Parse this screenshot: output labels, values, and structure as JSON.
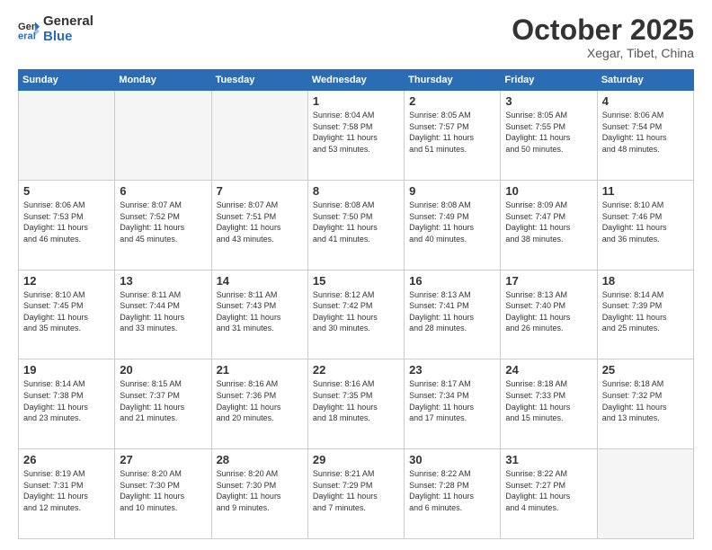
{
  "logo": {
    "line1": "General",
    "line2": "Blue"
  },
  "header": {
    "month": "October 2025",
    "location": "Xegar, Tibet, China"
  },
  "weekdays": [
    "Sunday",
    "Monday",
    "Tuesday",
    "Wednesday",
    "Thursday",
    "Friday",
    "Saturday"
  ],
  "weeks": [
    [
      {
        "day": "",
        "info": ""
      },
      {
        "day": "",
        "info": ""
      },
      {
        "day": "",
        "info": ""
      },
      {
        "day": "1",
        "info": "Sunrise: 8:04 AM\nSunset: 7:58 PM\nDaylight: 11 hours\nand 53 minutes."
      },
      {
        "day": "2",
        "info": "Sunrise: 8:05 AM\nSunset: 7:57 PM\nDaylight: 11 hours\nand 51 minutes."
      },
      {
        "day": "3",
        "info": "Sunrise: 8:05 AM\nSunset: 7:55 PM\nDaylight: 11 hours\nand 50 minutes."
      },
      {
        "day": "4",
        "info": "Sunrise: 8:06 AM\nSunset: 7:54 PM\nDaylight: 11 hours\nand 48 minutes."
      }
    ],
    [
      {
        "day": "5",
        "info": "Sunrise: 8:06 AM\nSunset: 7:53 PM\nDaylight: 11 hours\nand 46 minutes."
      },
      {
        "day": "6",
        "info": "Sunrise: 8:07 AM\nSunset: 7:52 PM\nDaylight: 11 hours\nand 45 minutes."
      },
      {
        "day": "7",
        "info": "Sunrise: 8:07 AM\nSunset: 7:51 PM\nDaylight: 11 hours\nand 43 minutes."
      },
      {
        "day": "8",
        "info": "Sunrise: 8:08 AM\nSunset: 7:50 PM\nDaylight: 11 hours\nand 41 minutes."
      },
      {
        "day": "9",
        "info": "Sunrise: 8:08 AM\nSunset: 7:49 PM\nDaylight: 11 hours\nand 40 minutes."
      },
      {
        "day": "10",
        "info": "Sunrise: 8:09 AM\nSunset: 7:47 PM\nDaylight: 11 hours\nand 38 minutes."
      },
      {
        "day": "11",
        "info": "Sunrise: 8:10 AM\nSunset: 7:46 PM\nDaylight: 11 hours\nand 36 minutes."
      }
    ],
    [
      {
        "day": "12",
        "info": "Sunrise: 8:10 AM\nSunset: 7:45 PM\nDaylight: 11 hours\nand 35 minutes."
      },
      {
        "day": "13",
        "info": "Sunrise: 8:11 AM\nSunset: 7:44 PM\nDaylight: 11 hours\nand 33 minutes."
      },
      {
        "day": "14",
        "info": "Sunrise: 8:11 AM\nSunset: 7:43 PM\nDaylight: 11 hours\nand 31 minutes."
      },
      {
        "day": "15",
        "info": "Sunrise: 8:12 AM\nSunset: 7:42 PM\nDaylight: 11 hours\nand 30 minutes."
      },
      {
        "day": "16",
        "info": "Sunrise: 8:13 AM\nSunset: 7:41 PM\nDaylight: 11 hours\nand 28 minutes."
      },
      {
        "day": "17",
        "info": "Sunrise: 8:13 AM\nSunset: 7:40 PM\nDaylight: 11 hours\nand 26 minutes."
      },
      {
        "day": "18",
        "info": "Sunrise: 8:14 AM\nSunset: 7:39 PM\nDaylight: 11 hours\nand 25 minutes."
      }
    ],
    [
      {
        "day": "19",
        "info": "Sunrise: 8:14 AM\nSunset: 7:38 PM\nDaylight: 11 hours\nand 23 minutes."
      },
      {
        "day": "20",
        "info": "Sunrise: 8:15 AM\nSunset: 7:37 PM\nDaylight: 11 hours\nand 21 minutes."
      },
      {
        "day": "21",
        "info": "Sunrise: 8:16 AM\nSunset: 7:36 PM\nDaylight: 11 hours\nand 20 minutes."
      },
      {
        "day": "22",
        "info": "Sunrise: 8:16 AM\nSunset: 7:35 PM\nDaylight: 11 hours\nand 18 minutes."
      },
      {
        "day": "23",
        "info": "Sunrise: 8:17 AM\nSunset: 7:34 PM\nDaylight: 11 hours\nand 17 minutes."
      },
      {
        "day": "24",
        "info": "Sunrise: 8:18 AM\nSunset: 7:33 PM\nDaylight: 11 hours\nand 15 minutes."
      },
      {
        "day": "25",
        "info": "Sunrise: 8:18 AM\nSunset: 7:32 PM\nDaylight: 11 hours\nand 13 minutes."
      }
    ],
    [
      {
        "day": "26",
        "info": "Sunrise: 8:19 AM\nSunset: 7:31 PM\nDaylight: 11 hours\nand 12 minutes."
      },
      {
        "day": "27",
        "info": "Sunrise: 8:20 AM\nSunset: 7:30 PM\nDaylight: 11 hours\nand 10 minutes."
      },
      {
        "day": "28",
        "info": "Sunrise: 8:20 AM\nSunset: 7:30 PM\nDaylight: 11 hours\nand 9 minutes."
      },
      {
        "day": "29",
        "info": "Sunrise: 8:21 AM\nSunset: 7:29 PM\nDaylight: 11 hours\nand 7 minutes."
      },
      {
        "day": "30",
        "info": "Sunrise: 8:22 AM\nSunset: 7:28 PM\nDaylight: 11 hours\nand 6 minutes."
      },
      {
        "day": "31",
        "info": "Sunrise: 8:22 AM\nSunset: 7:27 PM\nDaylight: 11 hours\nand 4 minutes."
      },
      {
        "day": "",
        "info": ""
      }
    ]
  ]
}
